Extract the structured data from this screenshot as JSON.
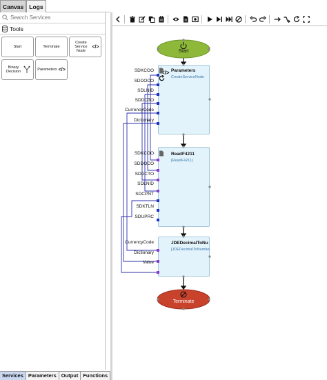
{
  "top_tabs": [
    "Canvas",
    "Logs"
  ],
  "search": {
    "placeholder": "Search Services"
  },
  "tools": {
    "label": "Tools",
    "items": [
      {
        "label": "Start"
      },
      {
        "label": "Terminate"
      },
      {
        "label": "Create Service Node",
        "icon": "</>"
      },
      {
        "label": "Binary Decision"
      },
      {
        "label": "Parameters",
        "icon": "</>"
      }
    ]
  },
  "bottom_tabs": [
    "Services",
    "Parameters",
    "Output",
    "Functions"
  ],
  "flow": {
    "start": {
      "label": "Start"
    },
    "terminate": {
      "label": "Terminate"
    },
    "parameters": {
      "title": "Parameters",
      "subtitle": "CreateServiceNode",
      "ports": [
        "SDKCOO",
        "SDDOCO",
        "SDLNID",
        "SDDCTO",
        "CurrencyCode",
        "Dictionary"
      ]
    },
    "readf4211": {
      "title": "ReadF4211",
      "subtitle": "[ReadF4211]",
      "ports": [
        "SDKCOO",
        "SDDOCO",
        "SDDCTO",
        "SDLNID",
        "SDCPNT",
        "SDKTLN",
        "SDUPRC"
      ]
    },
    "jde": {
      "title": "JDEDecimalToNu",
      "subtitle": "[JDEDecimalToNumber]",
      "ports": [
        "CurrencyCode",
        "Dictionary",
        "Value"
      ]
    }
  },
  "colors": {
    "start_fill": "#8db83a",
    "terminate_fill": "#c8422c",
    "node_fill": "#e3f3fb",
    "port_out": "#1f33c8",
    "port_in": "#8a3bd1",
    "wire": "#2a2fa8"
  }
}
